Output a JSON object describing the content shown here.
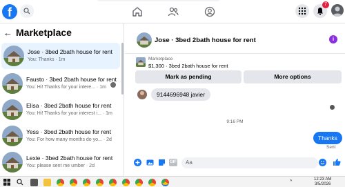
{
  "topbar": {
    "logo_letter": "f",
    "notification_count": "7"
  },
  "sidebar": {
    "back_glyph": "←",
    "title": "Marketplace",
    "conversations": [
      {
        "title": "Jose · 3bed 2bath house for rent",
        "preview": "You: Thanks · 1m"
      },
      {
        "title": "Fausto · 3bed 2bath house for rent",
        "preview": "You: Hi! Thanks for your intere... · 1m"
      },
      {
        "title": "Elisa · 3bed 2bath house for rent",
        "preview": "You: Hi! Thanks for your interest i... · 1m"
      },
      {
        "title": "Yess · 3bed 2bath house for rent",
        "preview": "You: For how many months do yo... · 2d"
      },
      {
        "title": "Lexie · 3bed 2bath house for rent",
        "preview": "You: please sent me umber · 2d"
      }
    ]
  },
  "chat": {
    "header_title": "Jose · 3bed 2bath house for rent",
    "info_glyph": "i",
    "listing": {
      "label": "Marketplace",
      "price_line": "$1,300 · 3bed 2bath house for rent"
    },
    "buttons": {
      "mark_pending": "Mark as pending",
      "more_options": "More options"
    },
    "incoming_message": "9144696948 javier",
    "timestamp": "9:16 PM",
    "outgoing_message": "Thanks",
    "sent_status": "Sent",
    "composer_placeholder": "Aa",
    "gif_label": "GIF"
  },
  "taskbar": {
    "time": "12:23 AM",
    "date": "3/5/2026",
    "tray_text": "^"
  },
  "colors": {
    "accent": "#1877f2",
    "badge": "#e41e3f",
    "active_conversation": "#e7f3ff",
    "info": "#8b2ee0"
  }
}
